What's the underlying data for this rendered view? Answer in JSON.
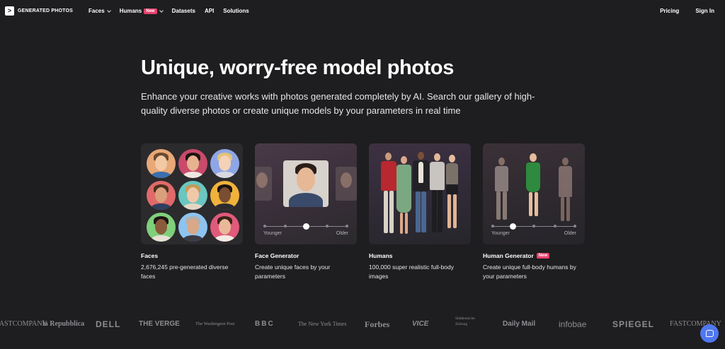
{
  "nav": {
    "brand": "GENERATED PHOTOS",
    "links": [
      {
        "label": "Faces",
        "dropdown": true
      },
      {
        "label": "Humans",
        "badge": "New",
        "dropdown": true
      },
      {
        "label": "Datasets"
      },
      {
        "label": "API"
      },
      {
        "label": "Solutions"
      }
    ],
    "pricing": "Pricing",
    "signin": "Sign In"
  },
  "hero": {
    "title": "Unique, worry-free model photos",
    "subtitle": "Enhance your creative works with photos generated completely by AI. Search our gallery of high-quality diverse photos or create unique models by your parameters in real time"
  },
  "cards": [
    {
      "title": "Faces",
      "desc": "2,676,245 pre-generated diverse faces"
    },
    {
      "title": "Face Generator",
      "desc": "Create unique faces by your parameters",
      "slider": {
        "min_label": "Younger",
        "max_label": "Older",
        "value": 0.5
      }
    },
    {
      "title": "Humans",
      "desc": "100,000 super realistic full-body images"
    },
    {
      "title": "Human Generator",
      "badge": "New",
      "desc": "Create unique full-body humans by your parameters",
      "slider": {
        "min_label": "Younger",
        "max_label": "Older",
        "value": 0.25
      }
    }
  ],
  "press_logos": [
    "FASTCOMPANY",
    "la Repubblica",
    "DELL",
    "THE VERGE",
    "The Washington Post",
    "BBC",
    "The New York Times",
    "Forbes",
    "VICE",
    "Süddeutsche Zeitung",
    "Daily Mail",
    "infobae",
    "SPIEGEL",
    "FASTCOMPANY"
  ],
  "colors": {
    "background": "#1e1d1f",
    "badge": "#e8406c",
    "chat": "#4f78f0"
  },
  "icons": {
    "logo": "generated-photos-logo-icon",
    "chat": "chat-bubble-icon"
  }
}
